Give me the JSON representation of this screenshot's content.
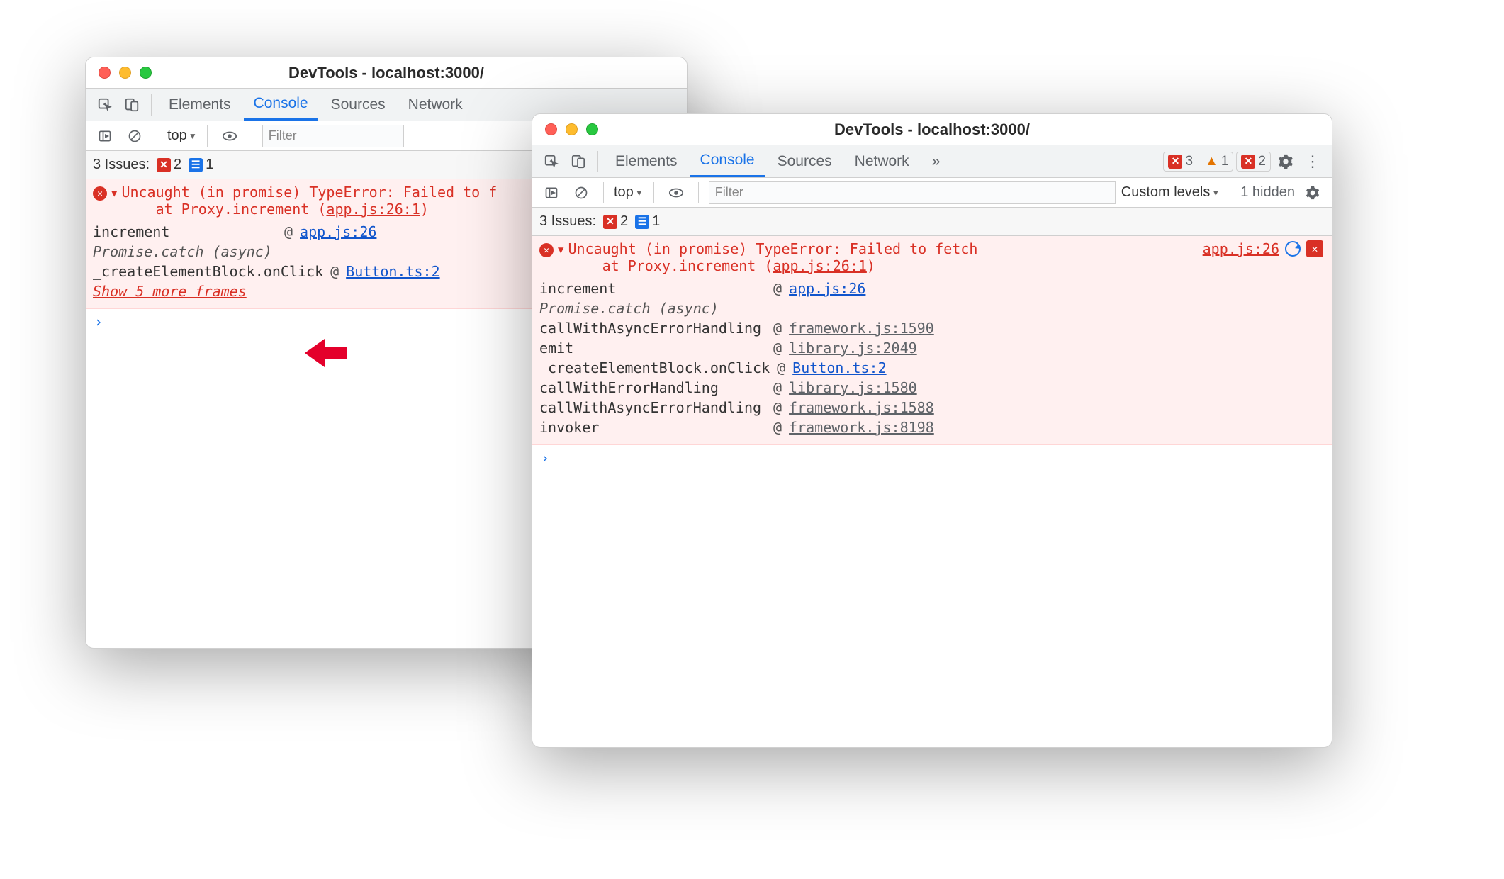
{
  "windowTitle": "DevTools - localhost:3000/",
  "tabs": [
    "Elements",
    "Console",
    "Sources",
    "Network"
  ],
  "activeTab": "Console",
  "moreTabs": "»",
  "filterPlaceholder": "Filter",
  "topContext": "top",
  "customLevels": "Custom levels",
  "hiddenText": "1 hidden",
  "issues": {
    "label": "3 Issues:",
    "errorCount": "2",
    "infoCount": "1"
  },
  "statusCounts": {
    "errors": "3",
    "warnings": "1",
    "overrides": "2"
  },
  "win1": {
    "error": {
      "line1": "Uncaught (in promise) TypeError: Failed to f",
      "line2": "    at Proxy.increment (",
      "sourceRef": "app.js:26:1",
      "stack": [
        {
          "fn": "increment",
          "at": "@",
          "link": "app.js:26",
          "cls": "ulink"
        },
        {
          "fn": "Promise.catch (async)",
          "italic": true
        },
        {
          "fn": "_createElementBlock.onClick",
          "at": "@",
          "link": "Button.ts:2",
          "cls": "ulink"
        }
      ],
      "showMore": "Show 5 more frames"
    }
  },
  "win2": {
    "error": {
      "line1": "Uncaught (in promise) TypeError: Failed to fetch",
      "line2": "    at Proxy.increment (",
      "sourceRef": "app.js:26:1",
      "srcRight": "app.js:26",
      "stack": [
        {
          "fn": "increment",
          "at": "@",
          "link": "app.js:26",
          "cls": "ulink"
        },
        {
          "fn": "Promise.catch (async)",
          "italic": true
        },
        {
          "fn": "callWithAsyncErrorHandling",
          "at": "@",
          "link": "framework.js:1590",
          "cls": "glink"
        },
        {
          "fn": "emit",
          "at": "@",
          "link": "library.js:2049",
          "cls": "glink"
        },
        {
          "fn": "_createElementBlock.onClick",
          "at": "@",
          "link": "Button.ts:2",
          "cls": "ulink"
        },
        {
          "fn": "callWithErrorHandling",
          "at": "@",
          "link": "library.js:1580",
          "cls": "glink"
        },
        {
          "fn": "callWithAsyncErrorHandling",
          "at": "@",
          "link": "framework.js:1588",
          "cls": "glink"
        },
        {
          "fn": "invoker",
          "at": "@",
          "link": "framework.js:8198",
          "cls": "glink"
        }
      ]
    }
  },
  "prompt": "›"
}
